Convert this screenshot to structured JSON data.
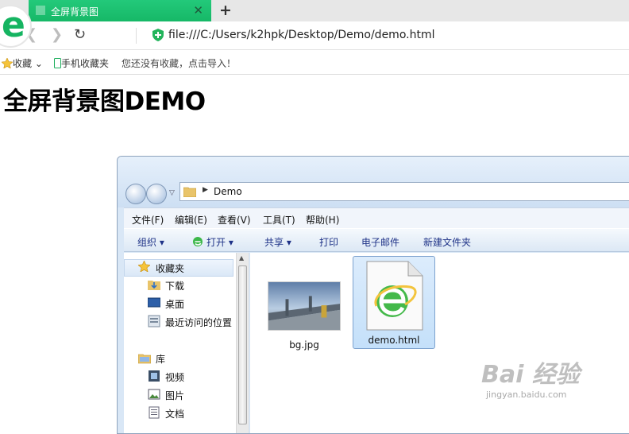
{
  "browser": {
    "tab_title": "全屏背景图",
    "url": "file:///C:/Users/k2hpk/Desktop/Demo/demo.html",
    "new_tab_symbol": "+",
    "close_symbol": "✕",
    "bookmarks": {
      "favorites": "收藏",
      "mobile_favorites": "手机收藏夹",
      "hint": "您还没有收藏，点击导入！"
    },
    "accent_color": "#1cc06f"
  },
  "page": {
    "heading": "全屏背景图DEMO"
  },
  "explorer": {
    "breadcrumb": "Demo",
    "menu": [
      "文件(F)",
      "编辑(E)",
      "查看(V)",
      "工具(T)",
      "帮助(H)"
    ],
    "commands": {
      "organize": "组织 ▾",
      "open": "打开 ▾",
      "share": "共享 ▾",
      "print": "打印",
      "email": "电子邮件",
      "new_folder": "新建文件夹"
    },
    "nav": {
      "favorites": "收藏夹",
      "downloads": "下载",
      "desktop": "桌面",
      "recent": "最近访问的位置",
      "libraries": "库",
      "videos": "视频",
      "pictures": "图片",
      "documents": "文档"
    },
    "files": [
      {
        "name": "bg.jpg"
      },
      {
        "name": "demo.html"
      }
    ]
  },
  "watermark": {
    "text": "Bai 经验",
    "sub": "jingyan.baidu.com"
  }
}
